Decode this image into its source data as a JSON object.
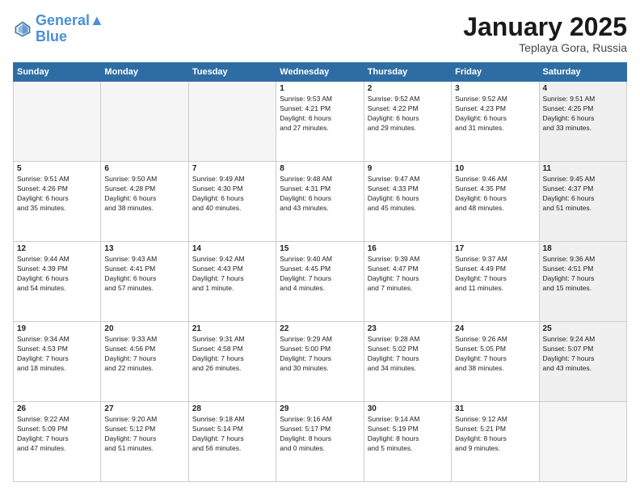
{
  "logo": {
    "line1": "General",
    "line2": "Blue"
  },
  "header": {
    "month": "January 2025",
    "location": "Teplaya Gora, Russia"
  },
  "weekdays": [
    "Sunday",
    "Monday",
    "Tuesday",
    "Wednesday",
    "Thursday",
    "Friday",
    "Saturday"
  ],
  "weeks": [
    [
      {
        "day": "",
        "content": "",
        "empty": true
      },
      {
        "day": "",
        "content": "",
        "empty": true
      },
      {
        "day": "",
        "content": "",
        "empty": true
      },
      {
        "day": "1",
        "content": "Sunrise: 9:53 AM\nSunset: 4:21 PM\nDaylight: 6 hours\nand 27 minutes.",
        "empty": false
      },
      {
        "day": "2",
        "content": "Sunrise: 9:52 AM\nSunset: 4:22 PM\nDaylight: 6 hours\nand 29 minutes.",
        "empty": false
      },
      {
        "day": "3",
        "content": "Sunrise: 9:52 AM\nSunset: 4:23 PM\nDaylight: 6 hours\nand 31 minutes.",
        "empty": false
      },
      {
        "day": "4",
        "content": "Sunrise: 9:51 AM\nSunset: 4:25 PM\nDaylight: 6 hours\nand 33 minutes.",
        "empty": false,
        "shaded": true
      }
    ],
    [
      {
        "day": "5",
        "content": "Sunrise: 9:51 AM\nSunset: 4:26 PM\nDaylight: 6 hours\nand 35 minutes.",
        "empty": false
      },
      {
        "day": "6",
        "content": "Sunrise: 9:50 AM\nSunset: 4:28 PM\nDaylight: 6 hours\nand 38 minutes.",
        "empty": false
      },
      {
        "day": "7",
        "content": "Sunrise: 9:49 AM\nSunset: 4:30 PM\nDaylight: 6 hours\nand 40 minutes.",
        "empty": false
      },
      {
        "day": "8",
        "content": "Sunrise: 9:48 AM\nSunset: 4:31 PM\nDaylight: 6 hours\nand 43 minutes.",
        "empty": false
      },
      {
        "day": "9",
        "content": "Sunrise: 9:47 AM\nSunset: 4:33 PM\nDaylight: 6 hours\nand 45 minutes.",
        "empty": false
      },
      {
        "day": "10",
        "content": "Sunrise: 9:46 AM\nSunset: 4:35 PM\nDaylight: 6 hours\nand 48 minutes.",
        "empty": false
      },
      {
        "day": "11",
        "content": "Sunrise: 9:45 AM\nSunset: 4:37 PM\nDaylight: 6 hours\nand 51 minutes.",
        "empty": false,
        "shaded": true
      }
    ],
    [
      {
        "day": "12",
        "content": "Sunrise: 9:44 AM\nSunset: 4:39 PM\nDaylight: 6 hours\nand 54 minutes.",
        "empty": false
      },
      {
        "day": "13",
        "content": "Sunrise: 9:43 AM\nSunset: 4:41 PM\nDaylight: 6 hours\nand 57 minutes.",
        "empty": false
      },
      {
        "day": "14",
        "content": "Sunrise: 9:42 AM\nSunset: 4:43 PM\nDaylight: 7 hours\nand 1 minute.",
        "empty": false
      },
      {
        "day": "15",
        "content": "Sunrise: 9:40 AM\nSunset: 4:45 PM\nDaylight: 7 hours\nand 4 minutes.",
        "empty": false
      },
      {
        "day": "16",
        "content": "Sunrise: 9:39 AM\nSunset: 4:47 PM\nDaylight: 7 hours\nand 7 minutes.",
        "empty": false
      },
      {
        "day": "17",
        "content": "Sunrise: 9:37 AM\nSunset: 4:49 PM\nDaylight: 7 hours\nand 11 minutes.",
        "empty": false
      },
      {
        "day": "18",
        "content": "Sunrise: 9:36 AM\nSunset: 4:51 PM\nDaylight: 7 hours\nand 15 minutes.",
        "empty": false,
        "shaded": true
      }
    ],
    [
      {
        "day": "19",
        "content": "Sunrise: 9:34 AM\nSunset: 4:53 PM\nDaylight: 7 hours\nand 18 minutes.",
        "empty": false
      },
      {
        "day": "20",
        "content": "Sunrise: 9:33 AM\nSunset: 4:56 PM\nDaylight: 7 hours\nand 22 minutes.",
        "empty": false
      },
      {
        "day": "21",
        "content": "Sunrise: 9:31 AM\nSunset: 4:58 PM\nDaylight: 7 hours\nand 26 minutes.",
        "empty": false
      },
      {
        "day": "22",
        "content": "Sunrise: 9:29 AM\nSunset: 5:00 PM\nDaylight: 7 hours\nand 30 minutes.",
        "empty": false
      },
      {
        "day": "23",
        "content": "Sunrise: 9:28 AM\nSunset: 5:02 PM\nDaylight: 7 hours\nand 34 minutes.",
        "empty": false
      },
      {
        "day": "24",
        "content": "Sunrise: 9:26 AM\nSunset: 5:05 PM\nDaylight: 7 hours\nand 38 minutes.",
        "empty": false
      },
      {
        "day": "25",
        "content": "Sunrise: 9:24 AM\nSunset: 5:07 PM\nDaylight: 7 hours\nand 43 minutes.",
        "empty": false,
        "shaded": true
      }
    ],
    [
      {
        "day": "26",
        "content": "Sunrise: 9:22 AM\nSunset: 5:09 PM\nDaylight: 7 hours\nand 47 minutes.",
        "empty": false
      },
      {
        "day": "27",
        "content": "Sunrise: 9:20 AM\nSunset: 5:12 PM\nDaylight: 7 hours\nand 51 minutes.",
        "empty": false
      },
      {
        "day": "28",
        "content": "Sunrise: 9:18 AM\nSunset: 5:14 PM\nDaylight: 7 hours\nand 56 minutes.",
        "empty": false
      },
      {
        "day": "29",
        "content": "Sunrise: 9:16 AM\nSunset: 5:17 PM\nDaylight: 8 hours\nand 0 minutes.",
        "empty": false
      },
      {
        "day": "30",
        "content": "Sunrise: 9:14 AM\nSunset: 5:19 PM\nDaylight: 8 hours\nand 5 minutes.",
        "empty": false
      },
      {
        "day": "31",
        "content": "Sunrise: 9:12 AM\nSunset: 5:21 PM\nDaylight: 8 hours\nand 9 minutes.",
        "empty": false
      },
      {
        "day": "",
        "content": "",
        "empty": true,
        "shaded": true
      }
    ]
  ]
}
